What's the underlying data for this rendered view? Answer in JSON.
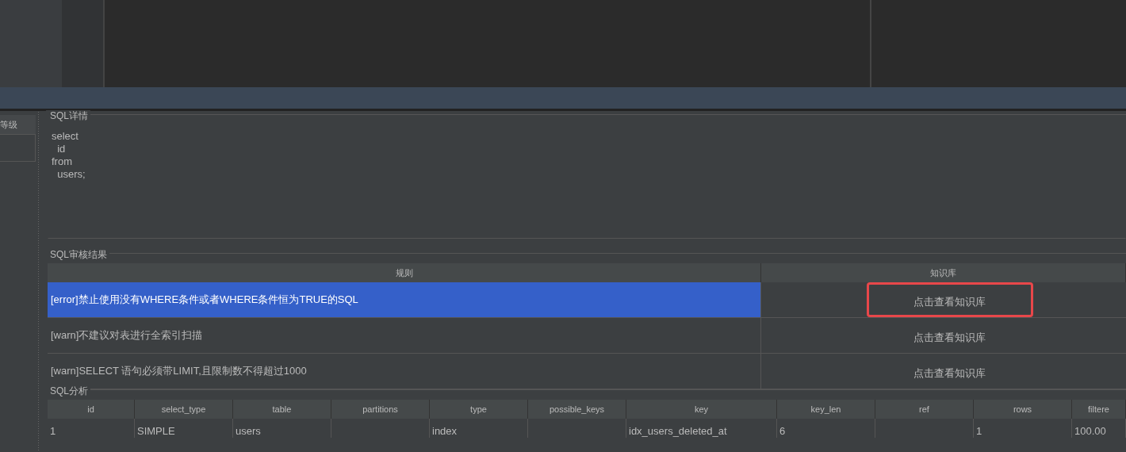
{
  "left_column": {
    "header": "等级"
  },
  "sql_detail": {
    "title": "SQL详情",
    "lines": [
      "select",
      "  id",
      "from",
      "  users;"
    ]
  },
  "audit": {
    "title": "SQL审核结果",
    "columns": [
      "规则",
      "知识库"
    ],
    "rows": [
      {
        "rule": "[error]禁止使用没有WHERE条件或者WHERE条件恒为TRUE的SQL",
        "link": "点击查看知识库",
        "selected": true,
        "highlighted": true
      },
      {
        "rule": "[warn]不建议对表进行全索引扫描",
        "link": "点击查看知识库",
        "selected": false,
        "highlighted": false
      },
      {
        "rule": "[warn]SELECT 语句必须带LIMIT,且限制数不得超过1000",
        "link": "点击查看知识库",
        "selected": false,
        "highlighted": false
      }
    ]
  },
  "analysis": {
    "title": "SQL分析",
    "columns": [
      "id",
      "select_type",
      "table",
      "partitions",
      "type",
      "possible_keys",
      "key",
      "key_len",
      "ref",
      "rows",
      "filtere"
    ],
    "rows": [
      [
        "1",
        "SIMPLE",
        "users",
        "",
        "index",
        "",
        "idx_users_deleted_at",
        "6",
        "",
        "1",
        "100.00"
      ]
    ]
  }
}
